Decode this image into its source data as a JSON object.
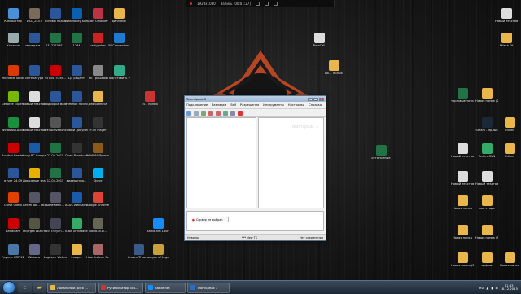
{
  "recording_bar": {
    "resolution": "1920x1080",
    "recording_label": "Запись [00:01:27]"
  },
  "desktop_left": [
    {
      "label": "Компьютер",
      "icon": "computer-icon",
      "color": "#4a90d9"
    },
    {
      "label": "DSC_2457",
      "icon": "image-icon",
      "color": "#7a6a5a"
    },
    {
      "label": "основы права",
      "icon": "word-icon",
      "color": "#2b579a"
    },
    {
      "label": "WebMoney Keeper W...",
      "icon": "webmoney-icon",
      "color": "#0a5fb0"
    },
    {
      "label": "Start Unlocker",
      "icon": "unlocker-icon",
      "color": "#b34"
    },
    {
      "label": "дипломы",
      "icon": "folder-icon",
      "color": "#e8b64a"
    },
    {
      "label": "Корзина",
      "icon": "recycle-bin-icon",
      "color": "#9aa"
    },
    {
      "label": "менеджм...",
      "icon": "word-icon",
      "color": "#2b579a"
    },
    {
      "label": "23122706S...",
      "icon": "excel-icon",
      "color": "#217346"
    },
    {
      "label": "1234",
      "icon": "excel-icon",
      "color": "#217346"
    },
    {
      "label": "partypoker",
      "icon": "poker-icon",
      "color": "#c22"
    },
    {
      "label": "RCConnection",
      "icon": "rc-icon",
      "color": "#1e7ad0"
    },
    {
      "label": "Microsoft Toolkit 2.4...",
      "icon": "office-icon",
      "color": "#d83b01"
    },
    {
      "label": "Литература",
      "icon": "word-icon",
      "color": "#2b579a"
    },
    {
      "label": "9575475156...",
      "icon": "pdf-icon",
      "color": "#c00"
    },
    {
      "label": "ЦЭ рецепт",
      "icon": "word-icon",
      "color": "#2b579a"
    },
    {
      "label": "НЕ Трошкая",
      "icon": "text-icon",
      "color": "#888"
    },
    {
      "label": "Подготовить установку ...",
      "icon": "setup-icon",
      "color": "#3a8"
    },
    {
      "label": "GeForce Experience",
      "icon": "nvidia-icon",
      "color": "#76b900"
    },
    {
      "label": "Новый текстовый...",
      "icon": "text-icon",
      "color": "#ddd"
    },
    {
      "label": "Подборка макета",
      "icon": "word-icon",
      "color": "#2b579a"
    },
    {
      "label": "Учебное пособие...",
      "icon": "word-icon",
      "color": "#2b579a"
    },
    {
      "label": "для бизнеса",
      "icon": "folder-icon",
      "color": "#e8b64a"
    },
    {
      "label": "Windows Loader",
      "icon": "windows-icon",
      "color": "#1a8f3c"
    },
    {
      "label": "Новый текстовый...",
      "icon": "text-icon",
      "color": "#ddd"
    },
    {
      "label": "SMSActivation...",
      "icon": "sms-icon",
      "color": "#555"
    },
    {
      "label": "Новый документ...",
      "icon": "word-icon",
      "color": "#2b579a"
    },
    {
      "label": "IP-TV Player",
      "icon": "tv-icon",
      "color": "#333"
    },
    {
      "label": "Acrobat Reader DC",
      "icon": "acrobat-icon",
      "color": "#c00"
    },
    {
      "label": "Sony PC Compani...",
      "icon": "sony-icon",
      "color": "#1a5aa8"
    },
    {
      "label": "22.04.2015",
      "icon": "excel-icon",
      "color": "#217346"
    },
    {
      "label": "Open Broadcast...",
      "icon": "obs-icon",
      "color": "#333"
    },
    {
      "label": "WoW 64 Ярлык",
      "icon": "wow-icon",
      "color": "#8a5a1a"
    },
    {
      "label": "отчет 24.09",
      "icon": "word-icon",
      "color": "#2b579a"
    },
    {
      "label": "Дорожные знаки",
      "icon": "road-sign-icon",
      "color": "#e8b100"
    },
    {
      "label": "12.04.2015",
      "icon": "excel-icon",
      "color": "#217346"
    },
    {
      "label": "видеоинфо...",
      "icon": "word-icon",
      "color": "#2b579a"
    },
    {
      "label": "Skype",
      "icon": "skype-icon",
      "color": "#00aff0"
    },
    {
      "label": "Curse Client",
      "icon": "curse-icon",
      "color": "#e04000"
    },
    {
      "label": "AMemTab... x64",
      "icon": "app-icon",
      "color": "#556"
    },
    {
      "label": "БолеМемТ...",
      "icon": "app-icon",
      "color": "#556"
    },
    {
      "label": "ASUS WebStorage",
      "icon": "asus-icon",
      "color": "#1a5aa8"
    },
    {
      "label": "Google Chrome",
      "icon": "chrome-icon",
      "color": "#db4437"
    },
    {
      "label": "Bandicam",
      "icon": "bandicam-icon",
      "color": "#c00"
    },
    {
      "label": "Mcgrgta Wizard Man",
      "icon": "wizard-icon",
      "color": "#554"
    },
    {
      "label": "EMTheyan...",
      "icon": "app-icon",
      "color": "#445"
    },
    {
      "label": "IObit Uninstaller",
      "icon": "iobit-icon",
      "color": "#3a6"
    },
    {
      "label": "world-of-w...",
      "icon": "game-icon",
      "color": "#665"
    },
    {
      "label": "Группа КВТ-12",
      "icon": "group-icon",
      "color": "#4a76a8"
    },
    {
      "label": "Webaca",
      "icon": "app-icon",
      "color": "#668"
    },
    {
      "label": "Logitech Webcam...",
      "icon": "webcam-icon",
      "color": "#333"
    },
    {
      "label": "imagez",
      "icon": "folder-icon",
      "color": "#e8b64a"
    },
    {
      "label": "Hearthstone Screenshot...",
      "icon": "hearthstone-icon",
      "color": "#a66"
    },
    {
      "label": "Frozen Throne",
      "icon": "warcraft-icon",
      "color": "#3a5a8a"
    },
    {
      "label": "League of Legends",
      "icon": "lol-icon",
      "color": "#c9a13a"
    },
    {
      "label": "Battle.net Launcher",
      "icon": "battlenet-icon",
      "color": "#148eff"
    },
    {
      "label": "TS - Ярлык",
      "icon": "teamspeak-icon",
      "color": "#c33"
    }
  ],
  "desktop_right": [
    {
      "label": "RaidCall",
      "icon": "raidcall-icon",
      "color": "#ddd"
    },
    {
      "label": "FHack Fit",
      "icon": "folder-icon",
      "color": "#e8b64a"
    },
    {
      "label": "Новый текстовый...",
      "icon": "text-icon",
      "color": "#ddd"
    },
    {
      "label": "Lol-1 Ярлык",
      "icon": "folder-icon",
      "color": "#e8b64a"
    },
    {
      "label": "торговые точки по всем точкам",
      "icon": "excel-icon",
      "color": "#217346"
    },
    {
      "label": "Новая папка (2)",
      "icon": "folder-icon",
      "color": "#e8b64a"
    },
    {
      "label": "Steam - Ярлык",
      "icon": "steam-icon",
      "color": "#1b2838"
    },
    {
      "label": "Edited",
      "icon": "folder-icon",
      "color": "#e8b64a"
    },
    {
      "label": "остатынные",
      "icon": "excel-icon",
      "color": "#217346"
    },
    {
      "label": "Новый текстовый...",
      "icon": "text-icon",
      "color": "#ddd"
    },
    {
      "label": "TorleneSVN",
      "icon": "tortoise-icon",
      "color": "#3a6"
    },
    {
      "label": "Edited",
      "icon": "folder-icon",
      "color": "#e8b64a"
    },
    {
      "label": "Новый текстовый...",
      "icon": "text-icon",
      "color": "#ddd"
    },
    {
      "label": "Новый текстовый...",
      "icon": "text-icon",
      "color": "#ddd"
    },
    {
      "label": "Новая папка",
      "icon": "folder-icon",
      "color": "#e8b64a"
    },
    {
      "label": "мое стадо",
      "icon": "folder-icon",
      "color": "#e8b64a"
    },
    {
      "label": "Новая папка",
      "icon": "folder-icon",
      "color": "#e8b64a"
    },
    {
      "label": "Новая папка (3)",
      "icon": "folder-icon",
      "color": "#e8b64a"
    },
    {
      "label": "Новая папка (2)",
      "icon": "folder-icon",
      "color": "#e8b64a"
    },
    {
      "label": "цифры",
      "icon": "folder-icon",
      "color": "#e8b64a"
    },
    {
      "label": "Новая папка",
      "icon": "folder-icon",
      "color": "#e8b64a"
    }
  ],
  "window": {
    "title": "TeamSpeak 3",
    "menu": [
      "Подключение",
      "Закладки",
      "Self",
      "Разрешения",
      "Инструменты",
      "Настройки",
      "Справка"
    ],
    "watermark": "teamspeak 3",
    "chat_tab_label": "Сервер не выбран",
    "status_left": "Невилос",
    "status_right": "*** New TS",
    "status_mid": "Нет соединения"
  },
  "taskbar": {
    "tasks": [
      {
        "label": "Локальный диск ...",
        "color": "#e8b64a"
      },
      {
        "label": "Русификатор Too...",
        "color": "#c33"
      },
      {
        "label": "Battle.net",
        "color": "#148eff"
      },
      {
        "label": "TeamSpeak 3",
        "color": "#2a6ac8"
      }
    ],
    "lang": "RU",
    "time": "11:43",
    "date": "18.12.2015"
  }
}
